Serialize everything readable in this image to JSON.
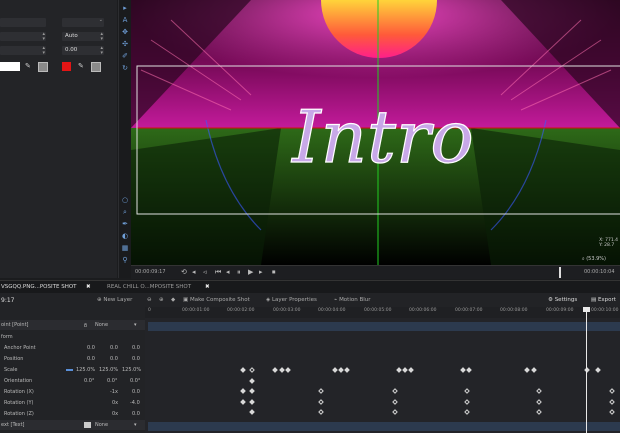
{
  "props": {
    "auto_label": "Auto",
    "value_000": "0.00"
  },
  "viewer": {
    "title": "Intro",
    "info_x": "X: 771.4",
    "info_y": "Y: 28.7",
    "zoom": "(53.9%)",
    "timecode_left": "00:00:09:17",
    "timecode_right": "00:00:10:04"
  },
  "tabs": [
    {
      "label": "VSGQQ.PNG...POSITE SHOT"
    },
    {
      "label": "REAL CHILL O...MPOSITE SHOT"
    }
  ],
  "toolbar": {
    "time": "9:17",
    "new_layer": "New Layer",
    "make_composite": "Make Composite Shot",
    "layer_properties": "Layer Properties",
    "motion_blur": "Motion Blur",
    "settings": "Settings",
    "export": "Export"
  },
  "ruler": [
    "0",
    "00:00:01:00",
    "00:00:02:00",
    "00:00:03:00",
    "00:00:04:00",
    "00:00:05:00",
    "00:00:06:00",
    "00:00:07:00",
    "00:00:08:00",
    "00:00:09:00",
    "00:00:10:00"
  ],
  "layers": {
    "layer1_name": "oint [Point]",
    "layer1_blend": "None",
    "transform": "form",
    "rows": [
      {
        "label": "Anchor Point",
        "v1": "0.0",
        "v2": "0.0",
        "v3": "0.0"
      },
      {
        "label": "Position",
        "v1": "0.0",
        "v2": "0.0",
        "v3": "0.0"
      },
      {
        "label": "Scale",
        "v1": "125.0%",
        "v2": "125.0%",
        "v3": "125.0%"
      },
      {
        "label": "Orientation",
        "v1": "0.0°",
        "v2": "0.0°",
        "v3": "0.0°"
      },
      {
        "label": "Rotation (X)",
        "v1": "",
        "v2": "-1x",
        "v3": "0.0"
      },
      {
        "label": "Rotation (Y)",
        "v1": "",
        "v2": "0x",
        "v3": "-4.0"
      },
      {
        "label": "Rotation (Z)",
        "v1": "",
        "v2": "0x",
        "v3": "0.0"
      }
    ],
    "layer2_name": "ext [Text]",
    "layer2_blend": "None"
  }
}
